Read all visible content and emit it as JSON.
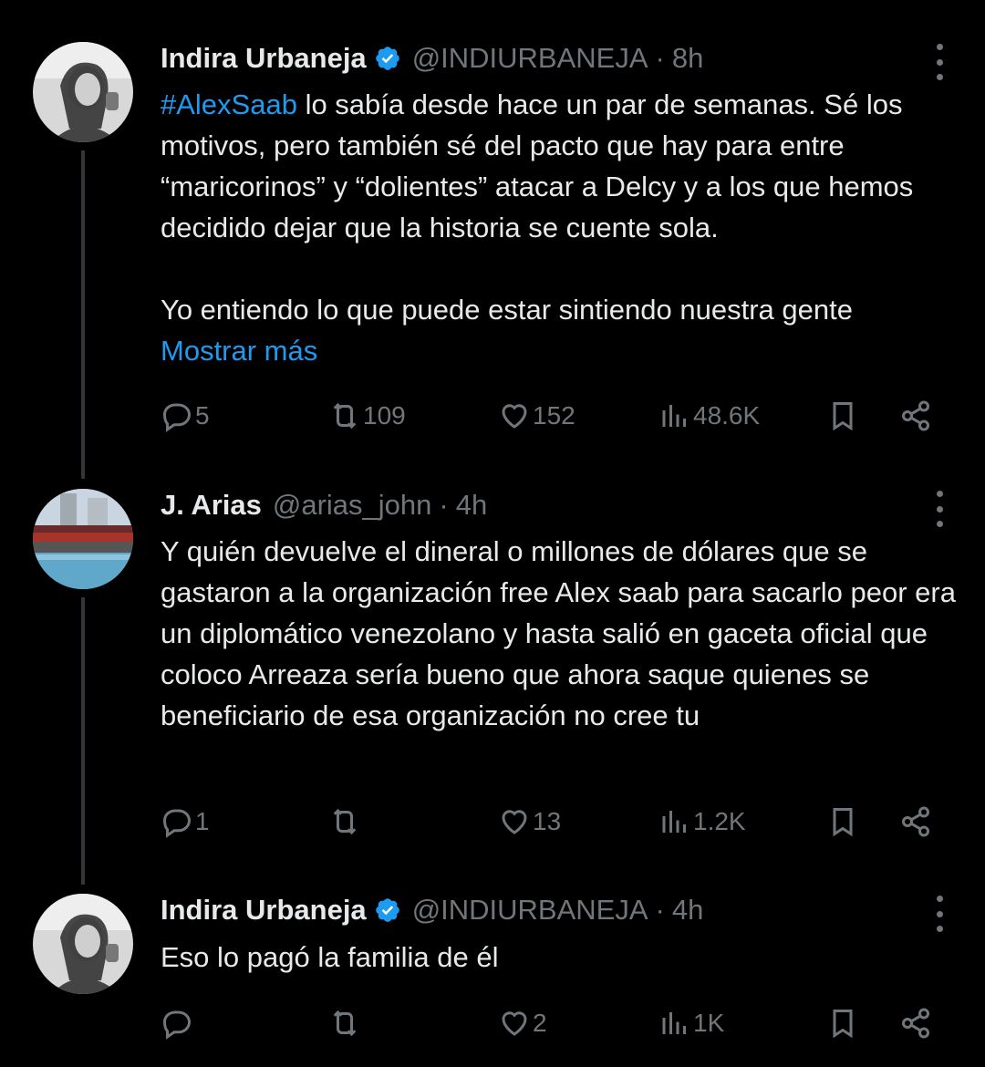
{
  "tweets": [
    {
      "name": "Indira Urbaneja",
      "handle": "@INDIURBANEJA",
      "sep": "·",
      "time": "8h",
      "hashtag": "#AlexSaab",
      "text_after_hashtag": " lo sabía desde hace un par de semanas. Sé los motivos, pero también sé del pacto que hay para entre “maricorinos” y “dolientes” atacar a Delcy y a los que hemos decidido dejar que la historia se cuente sola.",
      "text_para2": "Yo entiendo lo que puede estar sintiendo nuestra gente",
      "show_more": "Mostrar más",
      "replies": "5",
      "retweets": "109",
      "likes": "152",
      "views": "48.6K"
    },
    {
      "name": "J. Arias",
      "handle": "@arias_john",
      "sep": "·",
      "time": "4h",
      "text": "Y quién devuelve el dineral o millones de dólares que se gastaron a la organización free Alex saab para sacarlo peor era un diplomático venezolano y hasta salió en gaceta oficial que coloco Arreaza sería bueno que ahora saque quienes se beneficiario de esa organización no cree tu",
      "replies": "1",
      "retweets": "",
      "likes": "13",
      "views": "1.2K"
    },
    {
      "name": "Indira Urbaneja",
      "handle": "@INDIURBANEJA",
      "sep": "·",
      "time": "4h",
      "text": "Eso lo pagó la familia de él",
      "replies": "",
      "retweets": "",
      "likes": "2",
      "views": "1K"
    }
  ],
  "colors": {
    "background": "#000000",
    "text": "#e7e9ea",
    "muted": "#71767b",
    "link": "#1d9bf0",
    "verified": "#1d9bf0"
  }
}
